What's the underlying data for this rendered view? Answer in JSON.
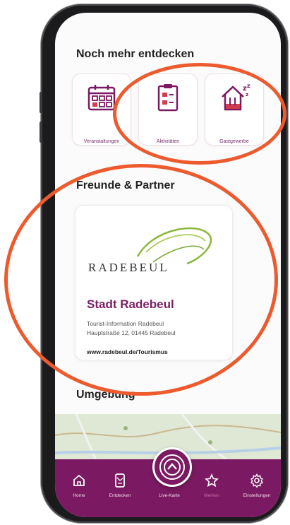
{
  "sections": {
    "more": "Noch mehr entdecken",
    "partners": "Freunde & Partner",
    "surroundings": "Umgebung"
  },
  "tiles": [
    {
      "label": "Veranstaltungen",
      "icon": "calendar-icon"
    },
    {
      "label": "Aktivitäten",
      "icon": "checklist-icon"
    },
    {
      "label": "Gastgewerbe",
      "icon": "house-sleep-icon"
    }
  ],
  "partner": {
    "logo_text": "RADEBEUL",
    "name": "Stadt Radebeul",
    "line1": "Tourist-Information Radebeul",
    "line2": "Hauptstraße 12, 01445 Radebeul",
    "link": "www.radebeul.de/Tourismus"
  },
  "tabs": [
    {
      "label": "Home",
      "icon": "home-icon"
    },
    {
      "label": "Entdecken",
      "icon": "phone-map-icon"
    },
    {
      "label": "Live-Karte",
      "icon": "live-map-icon"
    },
    {
      "label": "Merken",
      "icon": "star-icon"
    },
    {
      "label": "Einstellungen",
      "icon": "gear-icon"
    }
  ],
  "colors": {
    "brand": "#7b1a62",
    "annotation": "#ec5a2e",
    "icon_red": "#d23a4e"
  }
}
